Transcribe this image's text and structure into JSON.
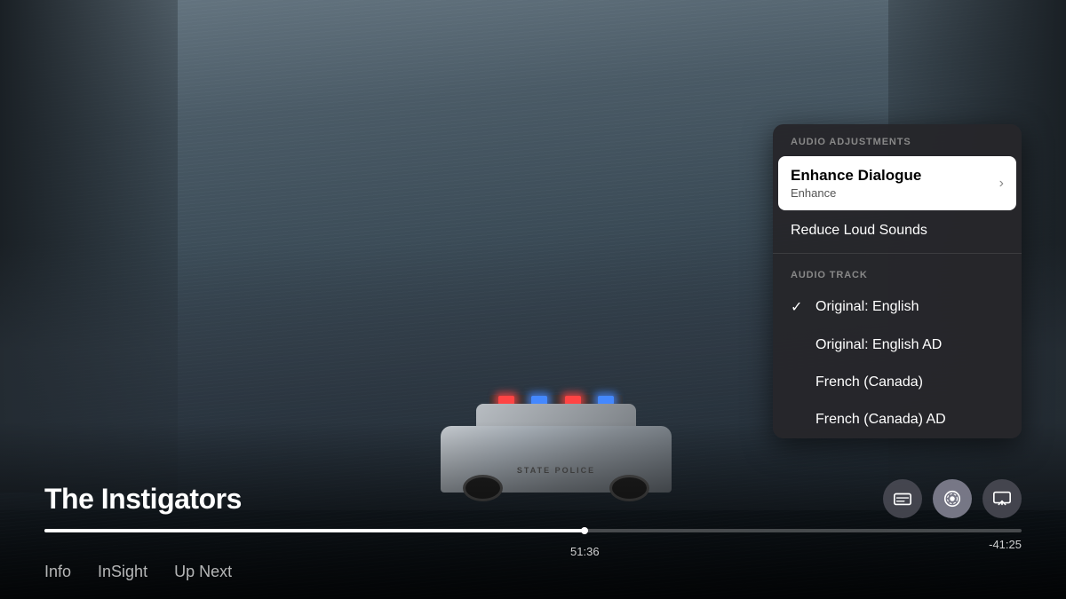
{
  "video": {
    "title": "The Instigators",
    "current_time": "51:36",
    "remaining_time": "-41:25",
    "progress_percent": 55.3
  },
  "controls": {
    "subtitles_icon": "💬",
    "audio_icon": "🔊",
    "airplay_icon": "📺"
  },
  "nav_tabs": [
    {
      "id": "info",
      "label": "Info",
      "active": false
    },
    {
      "id": "insight",
      "label": "InSight",
      "active": false
    },
    {
      "id": "up-next",
      "label": "Up Next",
      "active": false
    }
  ],
  "dropdown": {
    "audio_adjustments_header": "AUDIO ADJUSTMENTS",
    "enhance_dialogue_title": "Enhance Dialogue",
    "enhance_dialogue_subtitle": "Enhance",
    "reduce_loud_sounds_label": "Reduce Loud Sounds",
    "audio_track_header": "AUDIO TRACK",
    "audio_tracks": [
      {
        "id": "original-english",
        "label": "Original: English",
        "selected": true
      },
      {
        "id": "original-english-ad",
        "label": "Original: English AD",
        "selected": false
      },
      {
        "id": "french-canada",
        "label": "French (Canada)",
        "selected": false
      },
      {
        "id": "french-canada-ad",
        "label": "French (Canada) AD",
        "selected": false
      }
    ]
  }
}
